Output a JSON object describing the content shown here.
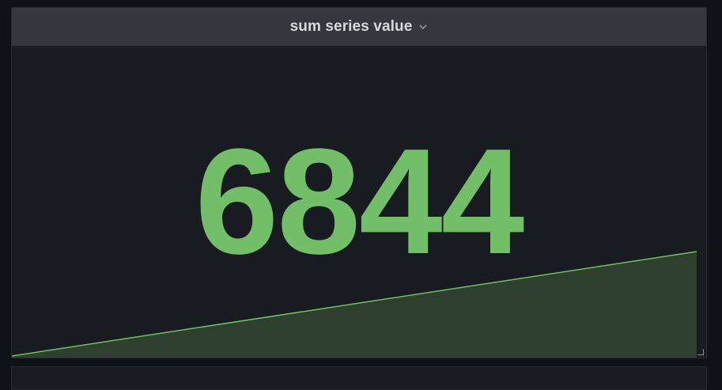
{
  "panel": {
    "title": "sum series value",
    "value": "6844",
    "colors": {
      "value": "#73bf69",
      "sparkline_line": "#73bf69",
      "sparkline_fill": "#2e3f2d",
      "header_bg": "#34373e",
      "panel_bg": "#181b1f"
    }
  },
  "chart_data": {
    "type": "area",
    "series": [
      {
        "values": [
          0,
          6844
        ]
      }
    ],
    "trend": "linear increasing",
    "grid": false,
    "legend": "none"
  }
}
